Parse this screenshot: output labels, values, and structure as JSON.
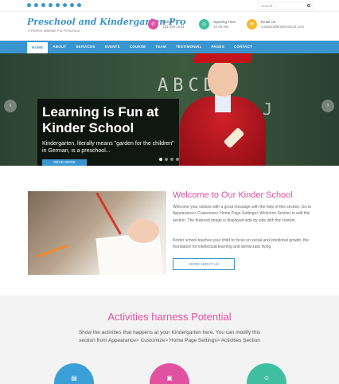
{
  "topbar": {
    "social_icons": [
      "facebook-icon",
      "twitter-icon",
      "youtube-icon",
      "instagram-icon",
      "pinterest-icon",
      "linkedin-icon",
      "snapchat-icon",
      "skype-icon"
    ],
    "search_placeholder": "Search ..."
  },
  "header": {
    "logo": "Preschool and Kindergarten Pro",
    "tagline": "A Perfect Website For Preschool",
    "contacts": [
      {
        "label": "Call Us",
        "value": "123 456 1234",
        "icon": "phone-icon",
        "color": "#e0519f"
      },
      {
        "label": "Opening Time",
        "value": "10:00 AM",
        "icon": "clock-icon",
        "color": "#3fbfa0"
      },
      {
        "label": "Email Us",
        "value": "contact@kinderschool.com",
        "icon": "mail-icon",
        "color": "#f5b82e"
      }
    ]
  },
  "nav": {
    "items": [
      "HOME",
      "ABOUT",
      "SERVICES",
      "EVENTS",
      "COURSE",
      "TEAM",
      "TESTIMONIAL",
      "PAGES",
      "CONTACT"
    ],
    "active": "HOME"
  },
  "hero": {
    "title": "Learning is Fun at Kinder School",
    "text": "Kindergarten, literally means \"garden for the children\" in German, is a preschool...",
    "button": "READ MORE",
    "letters_row1": "ABCDE",
    "letters_row2": "J",
    "prev": "‹",
    "next": "›"
  },
  "welcome": {
    "title": "Welcome to Our Kinder School",
    "text1": "Welcome your visitors with a great message with the help of this section. Go to Appearance> Customize> Home Page Settings> Welcome Section to edit this section. The featured image is displayed side by side with the content.",
    "text2": "Kinder school teaches your child to focus on social and emotional growth, the foundation for intellectual learning and democratic living.",
    "button": "MORE ABOUT US"
  },
  "activities": {
    "title": "Activities harness Potential",
    "text": "Show the activities that happens at your Kindergarten here. You can modify this section from Appearance> Customize> Home Page Settings> Activities Section",
    "icons": [
      {
        "name": "book-icon",
        "color": "#3ba0d8"
      },
      {
        "name": "easel-icon",
        "color": "#e0519f"
      },
      {
        "name": "person-icon",
        "color": "#3fbfa0"
      }
    ]
  },
  "colors": {
    "primary": "#3a95cf",
    "accent": "#e0519f"
  }
}
